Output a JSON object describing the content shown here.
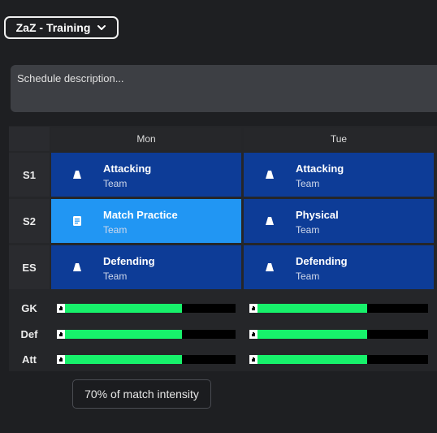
{
  "header": {
    "schedule_name": "ZaZ - Training"
  },
  "description": {
    "placeholder": "Schedule description..."
  },
  "days": [
    "Mon",
    "Tue"
  ],
  "sessions": [
    "S1",
    "S2",
    "ES"
  ],
  "cells": {
    "mon": [
      {
        "title": "Attacking",
        "subtitle": "Team",
        "icon": "cone-icon",
        "highlighted": false
      },
      {
        "title": "Match Practice",
        "subtitle": "Team",
        "icon": "document-icon",
        "highlighted": true
      },
      {
        "title": "Defending",
        "subtitle": "Team",
        "icon": "cone-icon",
        "highlighted": false
      }
    ],
    "tue": [
      {
        "title": "Attacking",
        "subtitle": "Team",
        "icon": "cone-icon",
        "highlighted": false
      },
      {
        "title": "Physical",
        "subtitle": "Team",
        "icon": "cone-icon",
        "highlighted": false
      },
      {
        "title": "Defending",
        "subtitle": "Team",
        "icon": "cone-icon",
        "highlighted": false
      }
    ]
  },
  "intensity": {
    "groups": [
      "GK",
      "Def",
      "Att"
    ],
    "mon_level": 0.7,
    "tue_level": 0.66
  },
  "tooltip": {
    "text": "70% of match intensity"
  },
  "colors": {
    "cell_dark": "#0d3c97",
    "cell_highlight": "#2196f3",
    "bar_fill": "#17f16b"
  }
}
